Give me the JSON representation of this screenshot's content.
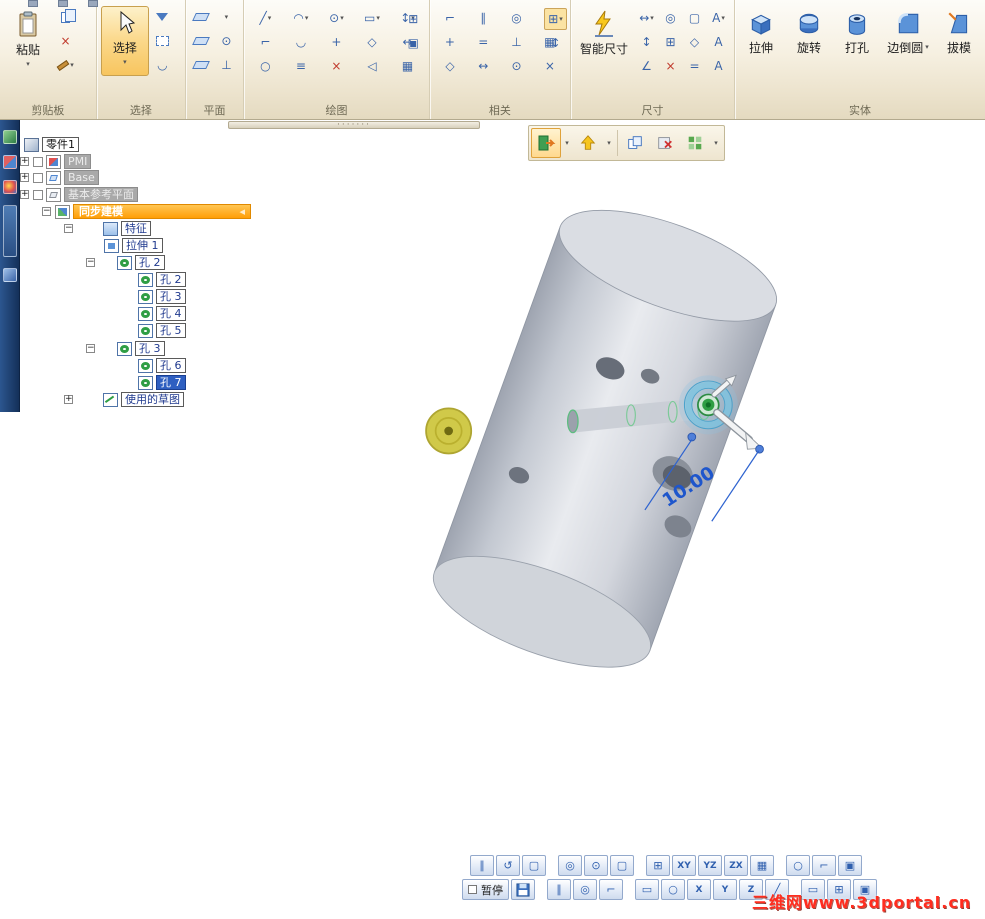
{
  "icons": {
    "dd": "▾",
    "pause": "∥",
    "undo": "↺",
    "page": "▢",
    "target": "◎",
    "axis": "⊙",
    "box": "⊞",
    "grid": "▦",
    "ring": "○",
    "corner": "⌐",
    "image": "▣",
    "line": "╱",
    "slash": "╲",
    "arc": "◠",
    "arc2": "◡",
    "rect": "▭",
    "plus": "+",
    "minus": "−",
    "equal": "=",
    "perp": "⊥",
    "angle": "∠",
    "diamond": "◇",
    "offset": "≡",
    "trim": "×",
    "mirror": "◁",
    "lr": "↔",
    "ud": "↕",
    "a": "A",
    "dots": "·······",
    "tri": "◂"
  },
  "ribbon": {
    "clipboard": {
      "label": "剪贴板",
      "paste": "粘贴"
    },
    "select": {
      "label": "选择",
      "button": "选择"
    },
    "plane": {
      "label": "平面"
    },
    "draw": {
      "label": "绘图"
    },
    "relate": {
      "label": "相关"
    },
    "dim": {
      "label": "尺寸",
      "smart": "智能尺寸"
    },
    "solids": {
      "label": "实体",
      "extrude": "拉伸",
      "revolve": "旋转",
      "hole": "打孔",
      "round": "边倒圆",
      "draft": "拔模"
    }
  },
  "tree": {
    "items": [
      {
        "label": "零件1"
      },
      {
        "label": "PMI"
      },
      {
        "label": "Base"
      },
      {
        "label": "基本参考平面"
      },
      {
        "label": "同步建模"
      },
      {
        "label": "特征"
      },
      {
        "label": "拉伸 1"
      },
      {
        "label": "孔 2"
      },
      {
        "label": "孔 2"
      },
      {
        "label": "孔 3"
      },
      {
        "label": "孔 4"
      },
      {
        "label": "孔 5"
      },
      {
        "label": "孔 3"
      },
      {
        "label": "孔 6"
      },
      {
        "label": "孔 7"
      },
      {
        "label": "使用的草图"
      }
    ]
  },
  "viewport": {
    "dimension_value": "10.00"
  },
  "command_bar": {
    "pause": "暂停",
    "planes": [
      "XY",
      "YZ",
      "ZX"
    ],
    "axes": [
      "X",
      "Y",
      "Z"
    ]
  },
  "watermark": "三维网www.3dportal.cn"
}
